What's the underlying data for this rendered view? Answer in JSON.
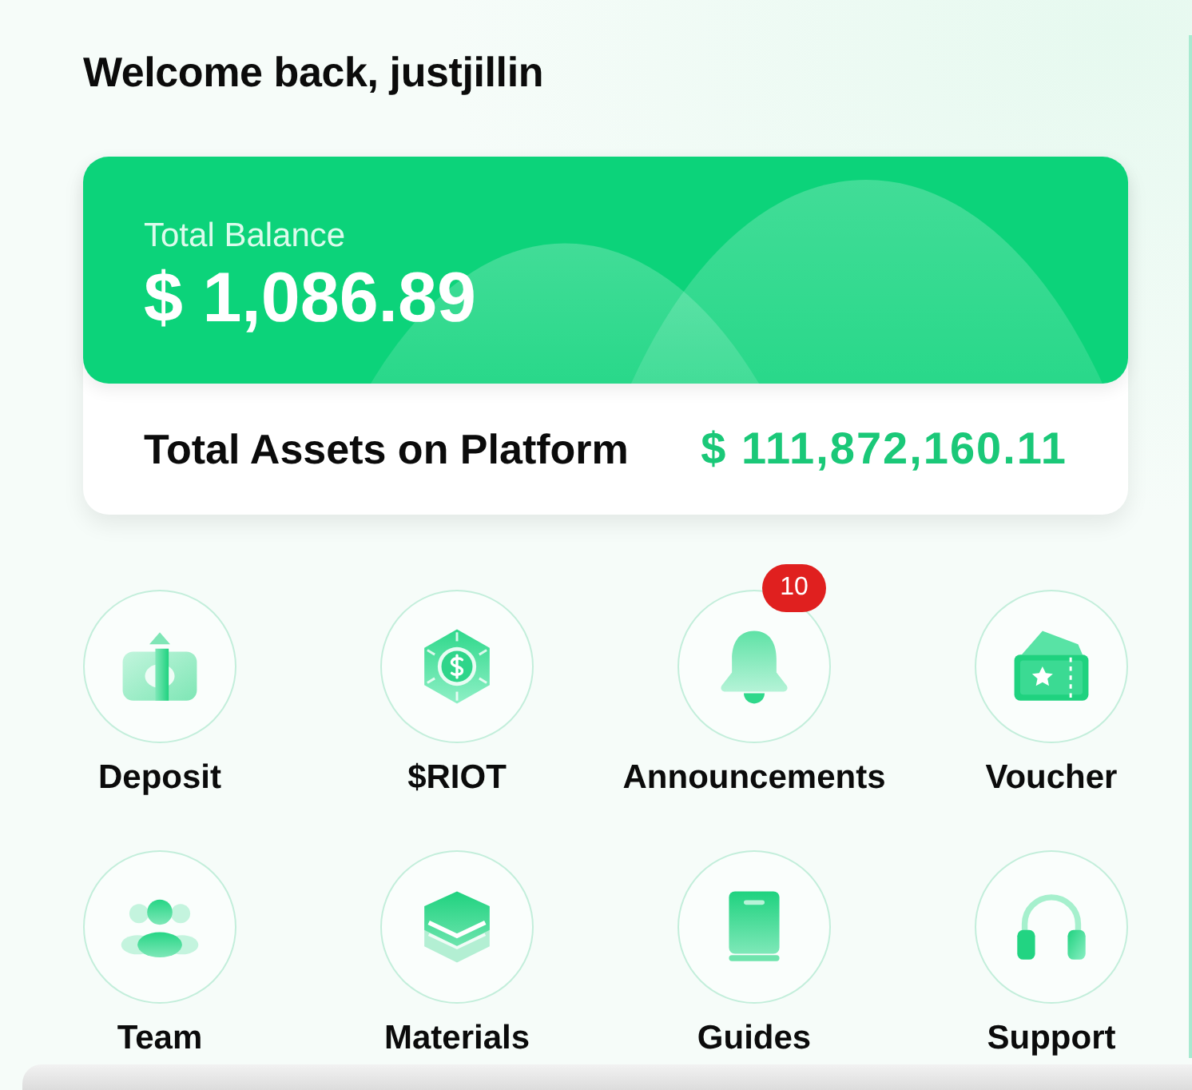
{
  "greeting": "Welcome back, justjillin",
  "balance_card": {
    "label": "Total Balance",
    "amount": "$ 1,086.89",
    "assets_label": "Total Assets on Platform",
    "assets_value": "$ 111,872,160.11"
  },
  "shortcuts": [
    {
      "label": "Deposit",
      "kind": "deposit"
    },
    {
      "label": "$RIOT",
      "kind": "coin"
    },
    {
      "label": "Announcements",
      "kind": "bell",
      "badge": "10"
    },
    {
      "label": "Voucher",
      "kind": "ticket"
    },
    {
      "label": "Team",
      "kind": "team"
    },
    {
      "label": "Materials",
      "kind": "layers"
    },
    {
      "label": "Guides",
      "kind": "book"
    },
    {
      "label": "Support",
      "kind": "headset"
    }
  ]
}
